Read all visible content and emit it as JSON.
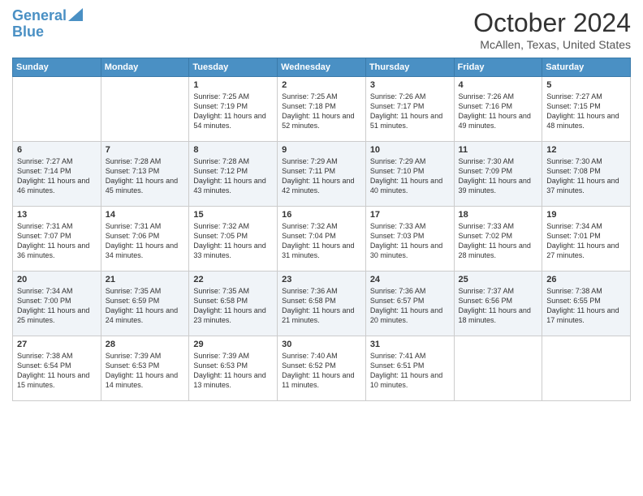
{
  "logo": {
    "line1": "General",
    "line2": "Blue"
  },
  "title": "October 2024",
  "location": "McAllen, Texas, United States",
  "days_of_week": [
    "Sunday",
    "Monday",
    "Tuesday",
    "Wednesday",
    "Thursday",
    "Friday",
    "Saturday"
  ],
  "weeks": [
    [
      {
        "day": "",
        "sunrise": "",
        "sunset": "",
        "daylight": ""
      },
      {
        "day": "",
        "sunrise": "",
        "sunset": "",
        "daylight": ""
      },
      {
        "day": "1",
        "sunrise": "Sunrise: 7:25 AM",
        "sunset": "Sunset: 7:19 PM",
        "daylight": "Daylight: 11 hours and 54 minutes."
      },
      {
        "day": "2",
        "sunrise": "Sunrise: 7:25 AM",
        "sunset": "Sunset: 7:18 PM",
        "daylight": "Daylight: 11 hours and 52 minutes."
      },
      {
        "day": "3",
        "sunrise": "Sunrise: 7:26 AM",
        "sunset": "Sunset: 7:17 PM",
        "daylight": "Daylight: 11 hours and 51 minutes."
      },
      {
        "day": "4",
        "sunrise": "Sunrise: 7:26 AM",
        "sunset": "Sunset: 7:16 PM",
        "daylight": "Daylight: 11 hours and 49 minutes."
      },
      {
        "day": "5",
        "sunrise": "Sunrise: 7:27 AM",
        "sunset": "Sunset: 7:15 PM",
        "daylight": "Daylight: 11 hours and 48 minutes."
      }
    ],
    [
      {
        "day": "6",
        "sunrise": "Sunrise: 7:27 AM",
        "sunset": "Sunset: 7:14 PM",
        "daylight": "Daylight: 11 hours and 46 minutes."
      },
      {
        "day": "7",
        "sunrise": "Sunrise: 7:28 AM",
        "sunset": "Sunset: 7:13 PM",
        "daylight": "Daylight: 11 hours and 45 minutes."
      },
      {
        "day": "8",
        "sunrise": "Sunrise: 7:28 AM",
        "sunset": "Sunset: 7:12 PM",
        "daylight": "Daylight: 11 hours and 43 minutes."
      },
      {
        "day": "9",
        "sunrise": "Sunrise: 7:29 AM",
        "sunset": "Sunset: 7:11 PM",
        "daylight": "Daylight: 11 hours and 42 minutes."
      },
      {
        "day": "10",
        "sunrise": "Sunrise: 7:29 AM",
        "sunset": "Sunset: 7:10 PM",
        "daylight": "Daylight: 11 hours and 40 minutes."
      },
      {
        "day": "11",
        "sunrise": "Sunrise: 7:30 AM",
        "sunset": "Sunset: 7:09 PM",
        "daylight": "Daylight: 11 hours and 39 minutes."
      },
      {
        "day": "12",
        "sunrise": "Sunrise: 7:30 AM",
        "sunset": "Sunset: 7:08 PM",
        "daylight": "Daylight: 11 hours and 37 minutes."
      }
    ],
    [
      {
        "day": "13",
        "sunrise": "Sunrise: 7:31 AM",
        "sunset": "Sunset: 7:07 PM",
        "daylight": "Daylight: 11 hours and 36 minutes."
      },
      {
        "day": "14",
        "sunrise": "Sunrise: 7:31 AM",
        "sunset": "Sunset: 7:06 PM",
        "daylight": "Daylight: 11 hours and 34 minutes."
      },
      {
        "day": "15",
        "sunrise": "Sunrise: 7:32 AM",
        "sunset": "Sunset: 7:05 PM",
        "daylight": "Daylight: 11 hours and 33 minutes."
      },
      {
        "day": "16",
        "sunrise": "Sunrise: 7:32 AM",
        "sunset": "Sunset: 7:04 PM",
        "daylight": "Daylight: 11 hours and 31 minutes."
      },
      {
        "day": "17",
        "sunrise": "Sunrise: 7:33 AM",
        "sunset": "Sunset: 7:03 PM",
        "daylight": "Daylight: 11 hours and 30 minutes."
      },
      {
        "day": "18",
        "sunrise": "Sunrise: 7:33 AM",
        "sunset": "Sunset: 7:02 PM",
        "daylight": "Daylight: 11 hours and 28 minutes."
      },
      {
        "day": "19",
        "sunrise": "Sunrise: 7:34 AM",
        "sunset": "Sunset: 7:01 PM",
        "daylight": "Daylight: 11 hours and 27 minutes."
      }
    ],
    [
      {
        "day": "20",
        "sunrise": "Sunrise: 7:34 AM",
        "sunset": "Sunset: 7:00 PM",
        "daylight": "Daylight: 11 hours and 25 minutes."
      },
      {
        "day": "21",
        "sunrise": "Sunrise: 7:35 AM",
        "sunset": "Sunset: 6:59 PM",
        "daylight": "Daylight: 11 hours and 24 minutes."
      },
      {
        "day": "22",
        "sunrise": "Sunrise: 7:35 AM",
        "sunset": "Sunset: 6:58 PM",
        "daylight": "Daylight: 11 hours and 23 minutes."
      },
      {
        "day": "23",
        "sunrise": "Sunrise: 7:36 AM",
        "sunset": "Sunset: 6:58 PM",
        "daylight": "Daylight: 11 hours and 21 minutes."
      },
      {
        "day": "24",
        "sunrise": "Sunrise: 7:36 AM",
        "sunset": "Sunset: 6:57 PM",
        "daylight": "Daylight: 11 hours and 20 minutes."
      },
      {
        "day": "25",
        "sunrise": "Sunrise: 7:37 AM",
        "sunset": "Sunset: 6:56 PM",
        "daylight": "Daylight: 11 hours and 18 minutes."
      },
      {
        "day": "26",
        "sunrise": "Sunrise: 7:38 AM",
        "sunset": "Sunset: 6:55 PM",
        "daylight": "Daylight: 11 hours and 17 minutes."
      }
    ],
    [
      {
        "day": "27",
        "sunrise": "Sunrise: 7:38 AM",
        "sunset": "Sunset: 6:54 PM",
        "daylight": "Daylight: 11 hours and 15 minutes."
      },
      {
        "day": "28",
        "sunrise": "Sunrise: 7:39 AM",
        "sunset": "Sunset: 6:53 PM",
        "daylight": "Daylight: 11 hours and 14 minutes."
      },
      {
        "day": "29",
        "sunrise": "Sunrise: 7:39 AM",
        "sunset": "Sunset: 6:53 PM",
        "daylight": "Daylight: 11 hours and 13 minutes."
      },
      {
        "day": "30",
        "sunrise": "Sunrise: 7:40 AM",
        "sunset": "Sunset: 6:52 PM",
        "daylight": "Daylight: 11 hours and 11 minutes."
      },
      {
        "day": "31",
        "sunrise": "Sunrise: 7:41 AM",
        "sunset": "Sunset: 6:51 PM",
        "daylight": "Daylight: 11 hours and 10 minutes."
      },
      {
        "day": "",
        "sunrise": "",
        "sunset": "",
        "daylight": ""
      },
      {
        "day": "",
        "sunrise": "",
        "sunset": "",
        "daylight": ""
      }
    ]
  ]
}
